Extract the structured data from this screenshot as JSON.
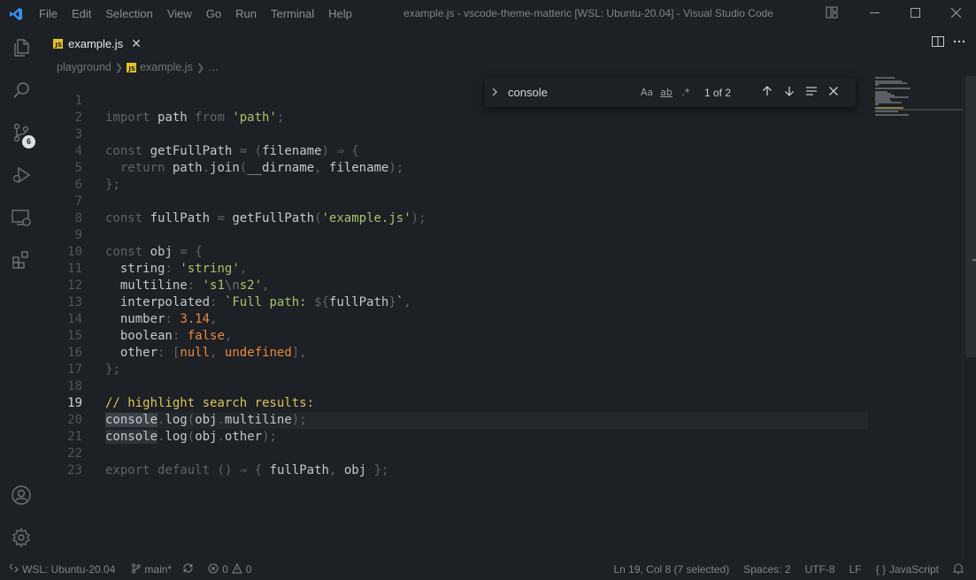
{
  "titlebar": {
    "menu": [
      "File",
      "Edit",
      "Selection",
      "View",
      "Go",
      "Run",
      "Terminal",
      "Help"
    ],
    "title": "example.js - vscode-theme-matteric [WSL: Ubuntu-20.04] - Visual Studio Code"
  },
  "activity": {
    "scm_badge": "6"
  },
  "tab": {
    "icon_label": "JS",
    "title": "example.js",
    "close": "✕"
  },
  "breadcrumb": {
    "folder": "playground",
    "file_icon": "JS",
    "file": "example.js",
    "more": "…"
  },
  "editor": {
    "current_line": 19,
    "lines": [
      {
        "n": "1"
      },
      {
        "n": "2"
      },
      {
        "n": "3"
      },
      {
        "n": "4"
      },
      {
        "n": "5"
      },
      {
        "n": "6"
      },
      {
        "n": "7"
      },
      {
        "n": "8"
      },
      {
        "n": "9"
      },
      {
        "n": "10"
      },
      {
        "n": "11"
      },
      {
        "n": "12"
      },
      {
        "n": "13"
      },
      {
        "n": "14"
      },
      {
        "n": "15"
      },
      {
        "n": "16"
      },
      {
        "n": "17"
      },
      {
        "n": "18"
      },
      {
        "n": "19"
      },
      {
        "n": "20"
      },
      {
        "n": "21"
      },
      {
        "n": "22"
      },
      {
        "n": "23"
      }
    ],
    "tokens": {
      "import": "import",
      "path": "path",
      "from": "from",
      "path_str": "'path'",
      "semi": ";",
      "const": "const",
      "getFullPath": "getFullPath",
      "eq": "=",
      "lp": "(",
      "filename": "filename",
      "rp": ")",
      "arrow": "⇒",
      "lb": "{",
      "return": "return",
      "join": "join",
      "dot": ".",
      "dirname": "__dirname",
      "comma": ",",
      "rb_semi": "};",
      "fullPath": "fullPath",
      "example_str": "'example.js'",
      "obj": "obj",
      "string_key": "string",
      "colon": ":",
      "string_val": "'string'",
      "multiline_key": "multiline",
      "s1": "'s1",
      "nl": "\\n",
      "s2": "s2'",
      "interp_key": "interpolated",
      "bt_open": "`Full path: ",
      "dollar": "${",
      "close_brace": "}",
      "bt_close": "`",
      "number_key": "number",
      "number_val": "3.14",
      "boolean_key": "boolean",
      "false_val": "false",
      "other_key": "other",
      "lbr": "[",
      "null_val": "null",
      "undefined_val": "undefined",
      "rbr": "]",
      "comment": "// highlight search results:",
      "console": "console",
      "log": "log",
      "multiline_prop": "multiline",
      "other_prop": "other",
      "export": "export",
      "default": "default",
      "empty_parens": "()",
      "rb": "}"
    }
  },
  "find": {
    "value": "console",
    "opt_case": "Aa",
    "opt_word": "ab",
    "opt_regex": ".*",
    "match_count": "1 of 2"
  },
  "statusbar": {
    "remote": "WSL: Ubuntu-20.04",
    "branch": "main*",
    "errors": "0",
    "warnings": "0",
    "position": "Ln 19, Col 8 (7 selected)",
    "spaces": "Spaces: 2",
    "encoding": "UTF-8",
    "eol": "LF",
    "language_braces": "{ }",
    "language": "JavaScript"
  },
  "colors": {
    "background": "#1d2024",
    "string": "#a6c36d",
    "number": "#e8893e",
    "comment": "#d8c45a",
    "accent": "#3794ff"
  }
}
